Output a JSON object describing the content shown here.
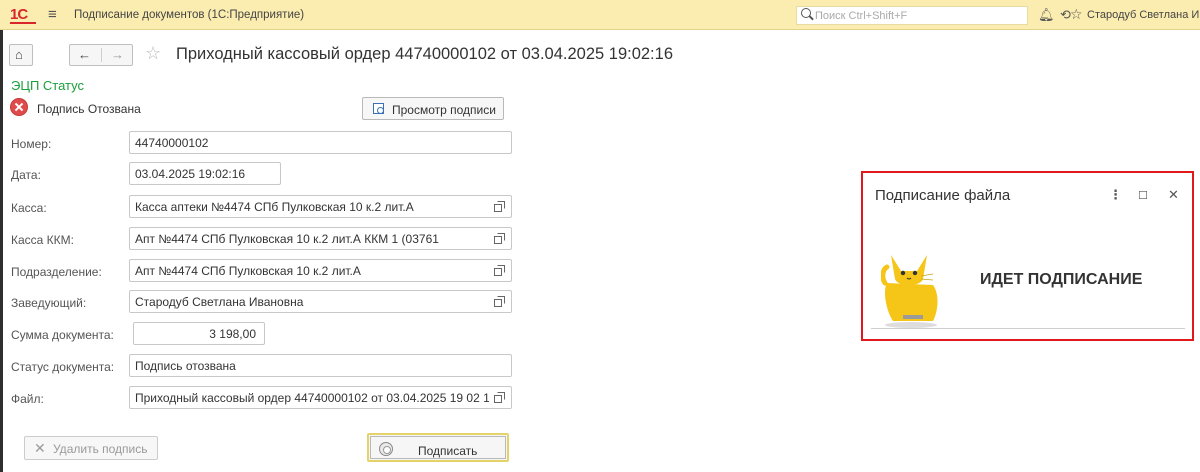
{
  "topbar": {
    "logo": "1С",
    "app_title": "Подписание документов  (1С:Предприятие)",
    "search_placeholder": "Поиск Ctrl+Shift+F",
    "user": "Стародуб Светлана Ива"
  },
  "document": {
    "title": "Приходный кассовый ордер 44740000102 от 03.04.2025 19:02:16",
    "edc_label": "ЭЦП Статус",
    "signature_status": "Подпись Отозвана",
    "view_signature_label": "Просмотр подписи"
  },
  "form": {
    "number_label": "Номер:",
    "number_value": "44740000102",
    "date_label": "Дата:",
    "date_value": "03.04.2025 19:02:16",
    "cash_label": "Касса:",
    "cash_value": "Касса аптеки №4474 СПб Пулковская 10 к.2 лит.А",
    "kkm_label": "Касса ККМ:",
    "kkm_value": "Апт №4474 СПб Пулковская 10 к.2 лит.А ККМ 1 (03761",
    "division_label": "Подразделение:",
    "division_value": "Апт №4474 СПб Пулковская 10 к.2 лит.А",
    "manager_label": "Заведующий:",
    "manager_value": "Стародуб Светлана Ивановна",
    "amount_label": "Сумма документа:",
    "amount_value": "3 198,00",
    "doc_status_label": "Статус документа:",
    "doc_status_value": "Подпись отозвана",
    "file_label": "Файл:",
    "file_value": "Приходный кассовый ордер 44740000102 от 03.04.2025 19 02 1"
  },
  "actions": {
    "delete_signature_label": "Удалить подпись",
    "sign_label": "Подписать"
  },
  "dialog": {
    "title": "Подписание файла",
    "status": "ИДЕТ ПОДПИСАНИЕ"
  },
  "colors": {
    "topbar_bg": "#fbedb0",
    "accent_green": "#1a9f3b",
    "highlight_red": "#e0191c",
    "logo_red": "#d8272c",
    "cat_yellow": "#f5c518"
  }
}
